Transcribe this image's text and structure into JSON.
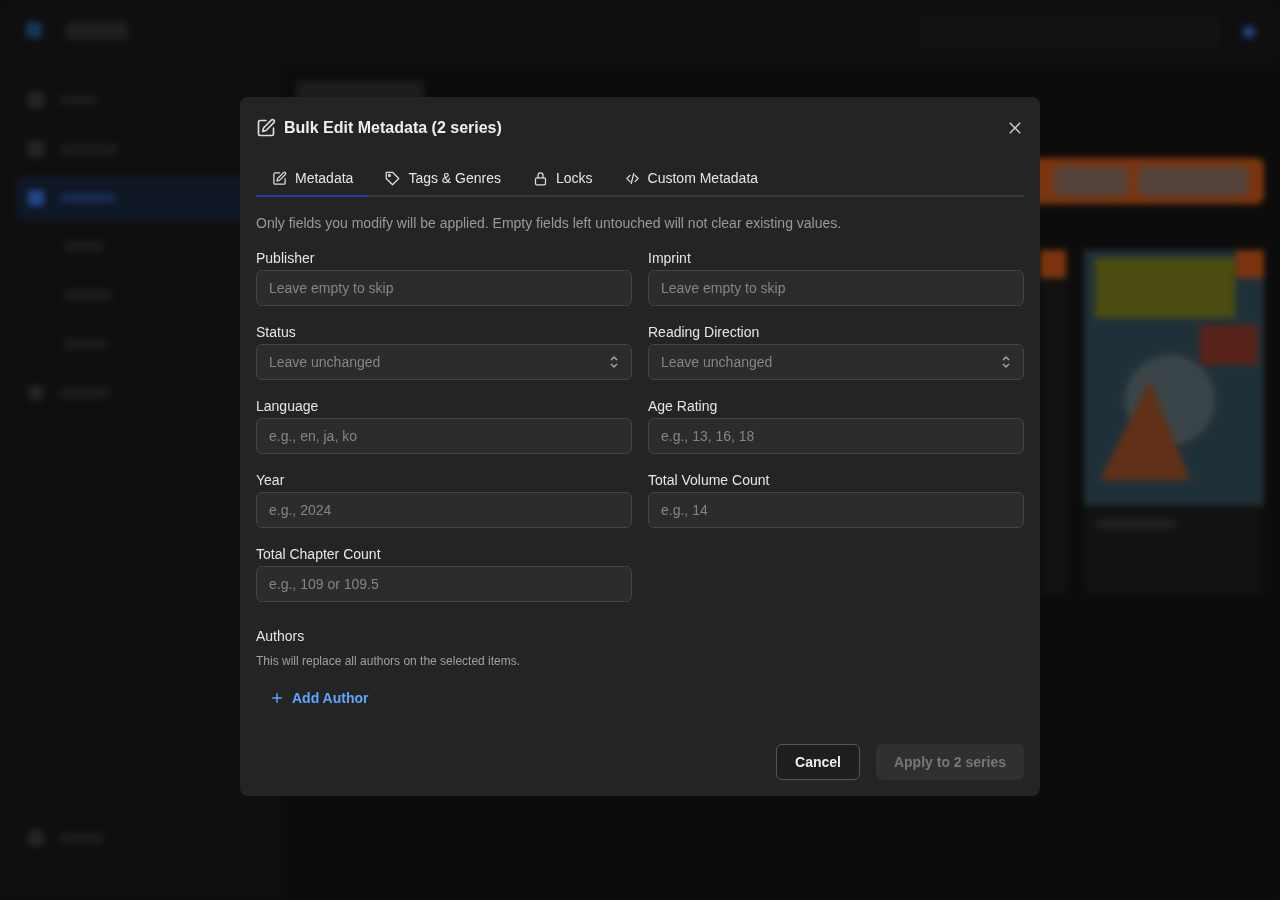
{
  "dialog": {
    "title": "Bulk Edit Metadata (2 series)",
    "tabs": [
      {
        "label": "Metadata",
        "selected": true
      },
      {
        "label": "Tags & Genres",
        "selected": false
      },
      {
        "label": "Locks",
        "selected": false
      },
      {
        "label": "Custom Metadata",
        "selected": false
      }
    ],
    "note": "Only fields you modify will be applied. Empty fields left untouched will not clear existing values.",
    "fields": [
      {
        "label": "Publisher",
        "kind": "text",
        "placeholder": "Leave empty to skip"
      },
      {
        "label": "Imprint",
        "kind": "text",
        "placeholder": "Leave empty to skip"
      },
      {
        "label": "Status",
        "kind": "select",
        "placeholder": "Leave unchanged"
      },
      {
        "label": "Reading Direction",
        "kind": "select",
        "placeholder": "Leave unchanged"
      },
      {
        "label": "Language",
        "kind": "text",
        "placeholder": "e.g., en, ja, ko"
      },
      {
        "label": "Age Rating",
        "kind": "text",
        "placeholder": "e.g., 13, 16, 18"
      },
      {
        "label": "Year",
        "kind": "text",
        "placeholder": "e.g., 2024"
      },
      {
        "label": "Total Volume Count",
        "kind": "text",
        "placeholder": "e.g., 14"
      },
      {
        "label": "Total Chapter Count",
        "kind": "text",
        "placeholder": "e.g., 109 or 109.5"
      }
    ],
    "authors": {
      "label": "Authors",
      "hint": "This will replace all authors on the selected items.",
      "add": "Add Author"
    },
    "buttons": [
      {
        "label": "Cancel",
        "disabled": false
      },
      {
        "label": "Apply to 2 series",
        "disabled": true
      }
    ]
  }
}
